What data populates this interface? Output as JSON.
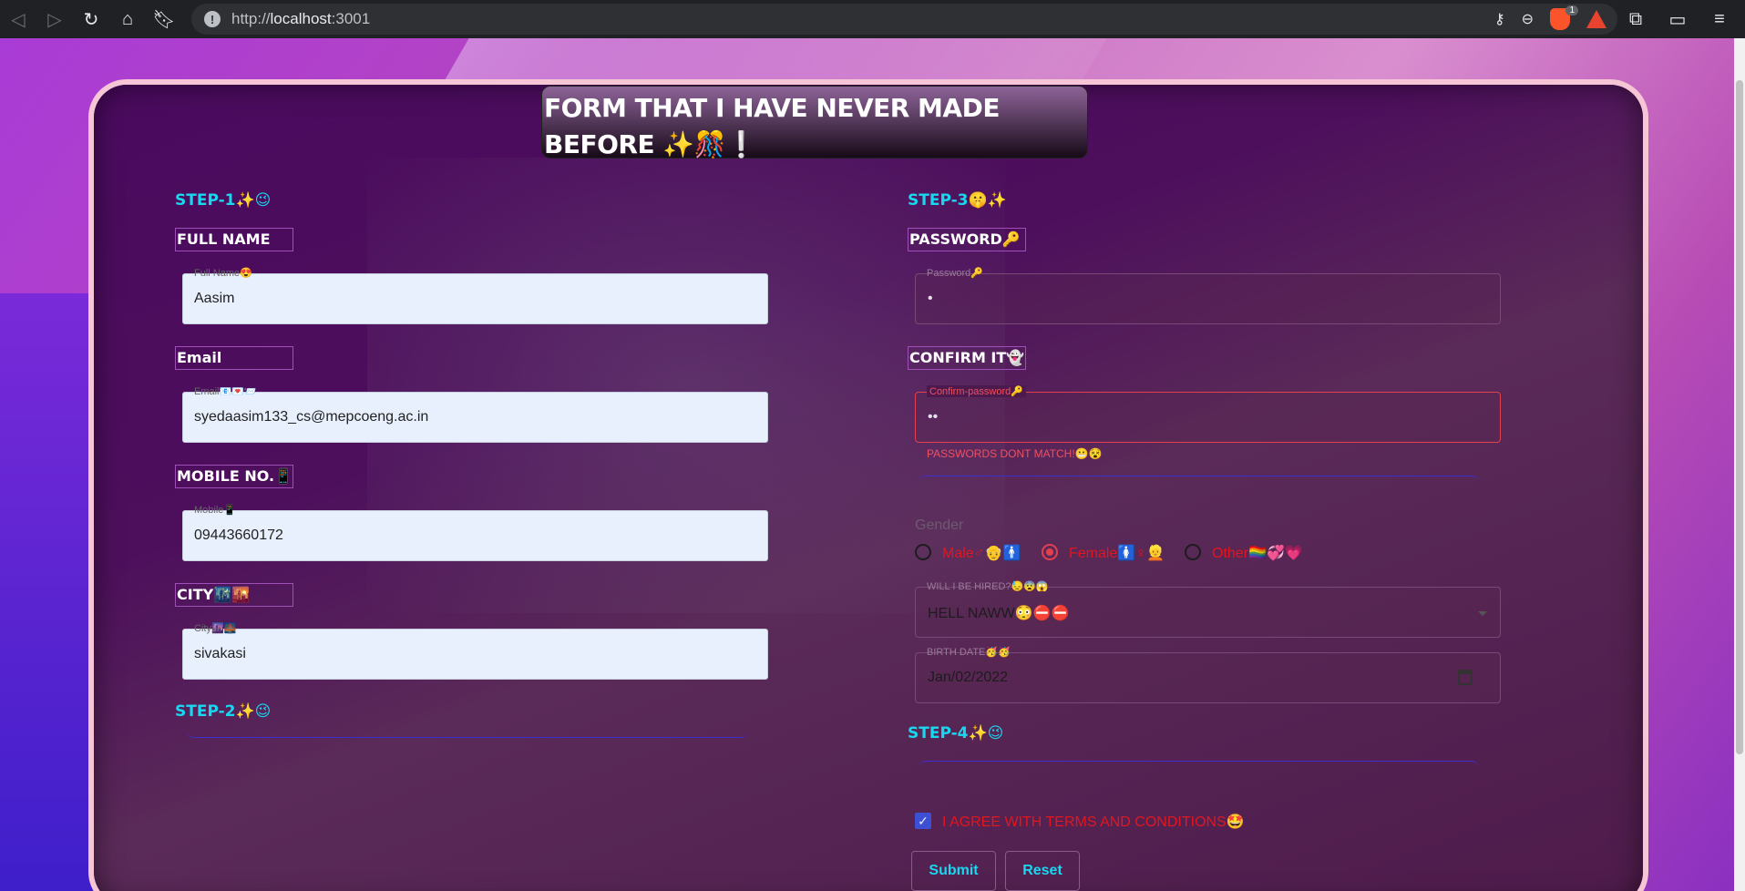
{
  "browser": {
    "url_scheme": "http://",
    "url_host": "localhost",
    "url_port": ":3001"
  },
  "form": {
    "title": "FORM THAT I HAVE NEVER MADE BEFORE ✨🎊❕",
    "step1": "STEP-1✨😉",
    "step2": "STEP-2✨😉",
    "step3": "STEP-3🤫✨",
    "step4": "STEP-4✨😉",
    "full_name": {
      "heading": "FULL NAME",
      "label": "Full Name😍",
      "value": "Aasim"
    },
    "email": {
      "heading": "Email",
      "label": "Email📧💌📨",
      "value": "syedaasim133_cs@mepcoeng.ac.in"
    },
    "mobile": {
      "heading": "MOBILE NO.📱",
      "label": "Mobile📱",
      "value": "09443660172"
    },
    "city": {
      "heading": "CITY🌃🌇",
      "label": "City🌆🌉",
      "value": "sivakasi"
    },
    "password": {
      "heading": "PASSWORD🔑",
      "label": "Password🔑",
      "value": "•"
    },
    "confirm": {
      "heading": "CONFIRM IT👻",
      "label": "Confirm-password🔑",
      "value": "••",
      "error": "PASSWORDS DONT MATCH!😬😵"
    },
    "gender": {
      "title": "Gender",
      "options": [
        "Male♂👴🚹",
        "Female🚺♀👱",
        "Other🏳️‍🌈💞💗"
      ],
      "selected": "Female🚺♀👱"
    },
    "hired": {
      "label": "WILL I BE HIRED?😓😨😱",
      "value": "HELL NAWW😳⛔⛔"
    },
    "birth": {
      "label": "BIRTH DATE🥳🥳",
      "value": "Jan/02/2022"
    },
    "terms": {
      "label": "I AGREE WITH TERMS AND CONDITIONS🤩",
      "checked": true
    },
    "buttons": {
      "submit": "Submit",
      "reset": "Reset"
    }
  },
  "colors": {
    "accent": "#18d8f0",
    "error": "#e2404f",
    "card": "#4a0a5e"
  }
}
